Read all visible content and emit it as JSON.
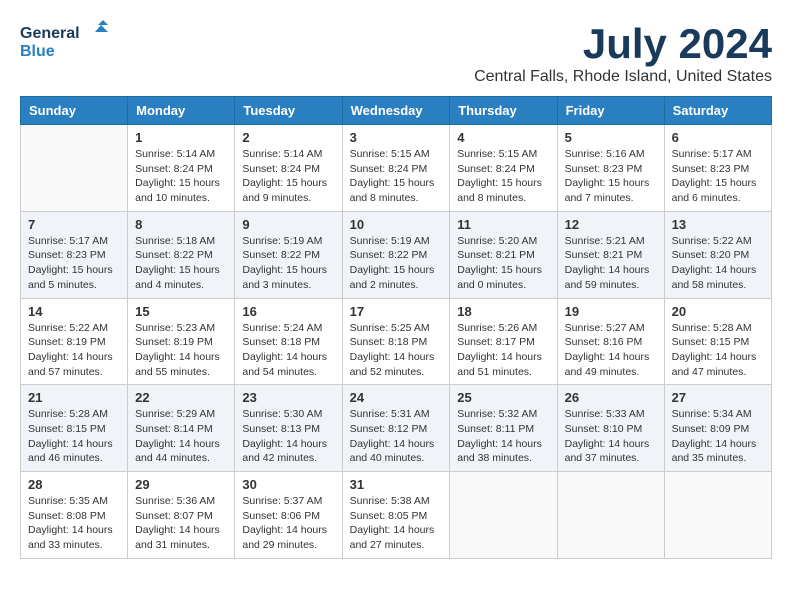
{
  "logo": {
    "general": "General",
    "blue": "Blue"
  },
  "title": "July 2024",
  "location": "Central Falls, Rhode Island, United States",
  "days_of_week": [
    "Sunday",
    "Monday",
    "Tuesday",
    "Wednesday",
    "Thursday",
    "Friday",
    "Saturday"
  ],
  "weeks": [
    [
      {
        "day": "",
        "info": ""
      },
      {
        "day": "1",
        "info": "Sunrise: 5:14 AM\nSunset: 8:24 PM\nDaylight: 15 hours\nand 10 minutes."
      },
      {
        "day": "2",
        "info": "Sunrise: 5:14 AM\nSunset: 8:24 PM\nDaylight: 15 hours\nand 9 minutes."
      },
      {
        "day": "3",
        "info": "Sunrise: 5:15 AM\nSunset: 8:24 PM\nDaylight: 15 hours\nand 8 minutes."
      },
      {
        "day": "4",
        "info": "Sunrise: 5:15 AM\nSunset: 8:24 PM\nDaylight: 15 hours\nand 8 minutes."
      },
      {
        "day": "5",
        "info": "Sunrise: 5:16 AM\nSunset: 8:23 PM\nDaylight: 15 hours\nand 7 minutes."
      },
      {
        "day": "6",
        "info": "Sunrise: 5:17 AM\nSunset: 8:23 PM\nDaylight: 15 hours\nand 6 minutes."
      }
    ],
    [
      {
        "day": "7",
        "info": "Sunrise: 5:17 AM\nSunset: 8:23 PM\nDaylight: 15 hours\nand 5 minutes."
      },
      {
        "day": "8",
        "info": "Sunrise: 5:18 AM\nSunset: 8:22 PM\nDaylight: 15 hours\nand 4 minutes."
      },
      {
        "day": "9",
        "info": "Sunrise: 5:19 AM\nSunset: 8:22 PM\nDaylight: 15 hours\nand 3 minutes."
      },
      {
        "day": "10",
        "info": "Sunrise: 5:19 AM\nSunset: 8:22 PM\nDaylight: 15 hours\nand 2 minutes."
      },
      {
        "day": "11",
        "info": "Sunrise: 5:20 AM\nSunset: 8:21 PM\nDaylight: 15 hours\nand 0 minutes."
      },
      {
        "day": "12",
        "info": "Sunrise: 5:21 AM\nSunset: 8:21 PM\nDaylight: 14 hours\nand 59 minutes."
      },
      {
        "day": "13",
        "info": "Sunrise: 5:22 AM\nSunset: 8:20 PM\nDaylight: 14 hours\nand 58 minutes."
      }
    ],
    [
      {
        "day": "14",
        "info": "Sunrise: 5:22 AM\nSunset: 8:19 PM\nDaylight: 14 hours\nand 57 minutes."
      },
      {
        "day": "15",
        "info": "Sunrise: 5:23 AM\nSunset: 8:19 PM\nDaylight: 14 hours\nand 55 minutes."
      },
      {
        "day": "16",
        "info": "Sunrise: 5:24 AM\nSunset: 8:18 PM\nDaylight: 14 hours\nand 54 minutes."
      },
      {
        "day": "17",
        "info": "Sunrise: 5:25 AM\nSunset: 8:18 PM\nDaylight: 14 hours\nand 52 minutes."
      },
      {
        "day": "18",
        "info": "Sunrise: 5:26 AM\nSunset: 8:17 PM\nDaylight: 14 hours\nand 51 minutes."
      },
      {
        "day": "19",
        "info": "Sunrise: 5:27 AM\nSunset: 8:16 PM\nDaylight: 14 hours\nand 49 minutes."
      },
      {
        "day": "20",
        "info": "Sunrise: 5:28 AM\nSunset: 8:15 PM\nDaylight: 14 hours\nand 47 minutes."
      }
    ],
    [
      {
        "day": "21",
        "info": "Sunrise: 5:28 AM\nSunset: 8:15 PM\nDaylight: 14 hours\nand 46 minutes."
      },
      {
        "day": "22",
        "info": "Sunrise: 5:29 AM\nSunset: 8:14 PM\nDaylight: 14 hours\nand 44 minutes."
      },
      {
        "day": "23",
        "info": "Sunrise: 5:30 AM\nSunset: 8:13 PM\nDaylight: 14 hours\nand 42 minutes."
      },
      {
        "day": "24",
        "info": "Sunrise: 5:31 AM\nSunset: 8:12 PM\nDaylight: 14 hours\nand 40 minutes."
      },
      {
        "day": "25",
        "info": "Sunrise: 5:32 AM\nSunset: 8:11 PM\nDaylight: 14 hours\nand 38 minutes."
      },
      {
        "day": "26",
        "info": "Sunrise: 5:33 AM\nSunset: 8:10 PM\nDaylight: 14 hours\nand 37 minutes."
      },
      {
        "day": "27",
        "info": "Sunrise: 5:34 AM\nSunset: 8:09 PM\nDaylight: 14 hours\nand 35 minutes."
      }
    ],
    [
      {
        "day": "28",
        "info": "Sunrise: 5:35 AM\nSunset: 8:08 PM\nDaylight: 14 hours\nand 33 minutes."
      },
      {
        "day": "29",
        "info": "Sunrise: 5:36 AM\nSunset: 8:07 PM\nDaylight: 14 hours\nand 31 minutes."
      },
      {
        "day": "30",
        "info": "Sunrise: 5:37 AM\nSunset: 8:06 PM\nDaylight: 14 hours\nand 29 minutes."
      },
      {
        "day": "31",
        "info": "Sunrise: 5:38 AM\nSunset: 8:05 PM\nDaylight: 14 hours\nand 27 minutes."
      },
      {
        "day": "",
        "info": ""
      },
      {
        "day": "",
        "info": ""
      },
      {
        "day": "",
        "info": ""
      }
    ]
  ]
}
